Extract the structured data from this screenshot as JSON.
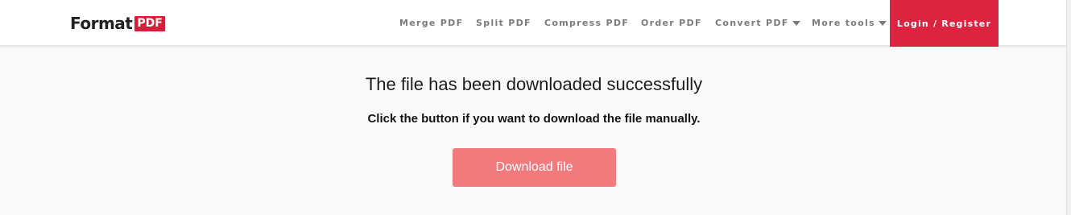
{
  "header": {
    "logo_word": "Format",
    "logo_badge": "PDF",
    "nav": {
      "merge": "Merge PDF",
      "split": "Split PDF",
      "compress": "Compress PDF",
      "order": "Order PDF",
      "convert": "Convert PDF",
      "more": "More tools"
    },
    "login_label": "Login / Register"
  },
  "main": {
    "title": "The file has been downloaded successfully",
    "subtitle": "Click the button if you want to download the file manually.",
    "download_label": "Download file"
  },
  "colors": {
    "brand_red": "#dc2440",
    "download_button": "#f07a7c",
    "nav_text": "#7b7b7b"
  }
}
